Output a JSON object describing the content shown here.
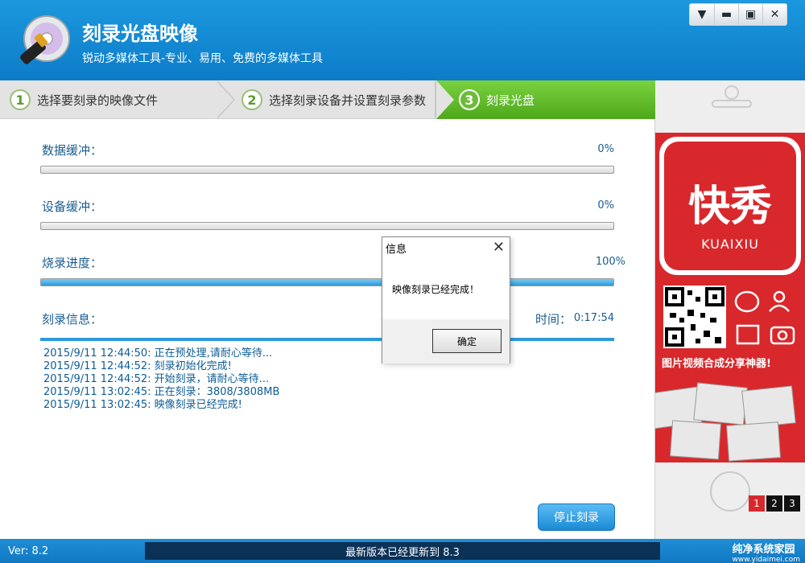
{
  "app": {
    "title": "刻录光盘映像",
    "subtitle": "锐动多媒体工具-专业、易用、免费的多媒体工具"
  },
  "window_controls": [
    "menu-icon",
    "minimize-icon",
    "maximize-icon",
    "close-icon"
  ],
  "steps": [
    {
      "num": "1",
      "label": "选择要刻录的映像文件",
      "active": false
    },
    {
      "num": "2",
      "label": "选择刻录设备并设置刻录参数",
      "active": false
    },
    {
      "num": "3",
      "label": "刻录光盘",
      "active": true
    }
  ],
  "progress": {
    "data_buffer": {
      "label": "数据缓冲：",
      "value": "0%",
      "fraction": 0
    },
    "device_buffer": {
      "label": "设备缓冲：",
      "value": "0%",
      "fraction": 0
    },
    "burn_progress": {
      "label": "烧录进度：",
      "value": "100%",
      "fraction": 1
    }
  },
  "burn_info": {
    "label": "刻录信息：",
    "time_label": "时间：",
    "time_value": "0:17:54",
    "log": [
      "2015/9/11 12:44:50: 正在预处理,请耐心等待...",
      "2015/9/11 12:44:52: 刻录初始化完成!",
      "2015/9/11 12:44:52: 开始刻录，请耐心等待...",
      "2015/9/11 13:02:45: 正在刻录：3808/3808MB",
      "2015/9/11 13:02:45:  映像刻录已经完成!"
    ]
  },
  "buttons": {
    "stop": "停止刻录"
  },
  "dialog": {
    "title": "信息",
    "message": "映像刻录已经完成！",
    "ok": "确定"
  },
  "ad": {
    "brand": "快秀",
    "brand_en": "KUAIXIU",
    "slogan": "图片视频合成分享神器!",
    "pages": [
      "1",
      "2",
      "3"
    ]
  },
  "status": {
    "version": "Ver: 8.2",
    "update": "最新版本已经更新到 8.3",
    "watermark": "纯净系统家园",
    "watermark_url": "www.yidaimei.com"
  },
  "colors": {
    "header": "#1b98de",
    "step_active": "#5cb82a",
    "ad_red": "#d8282c",
    "text_blue": "#1a5d90"
  }
}
